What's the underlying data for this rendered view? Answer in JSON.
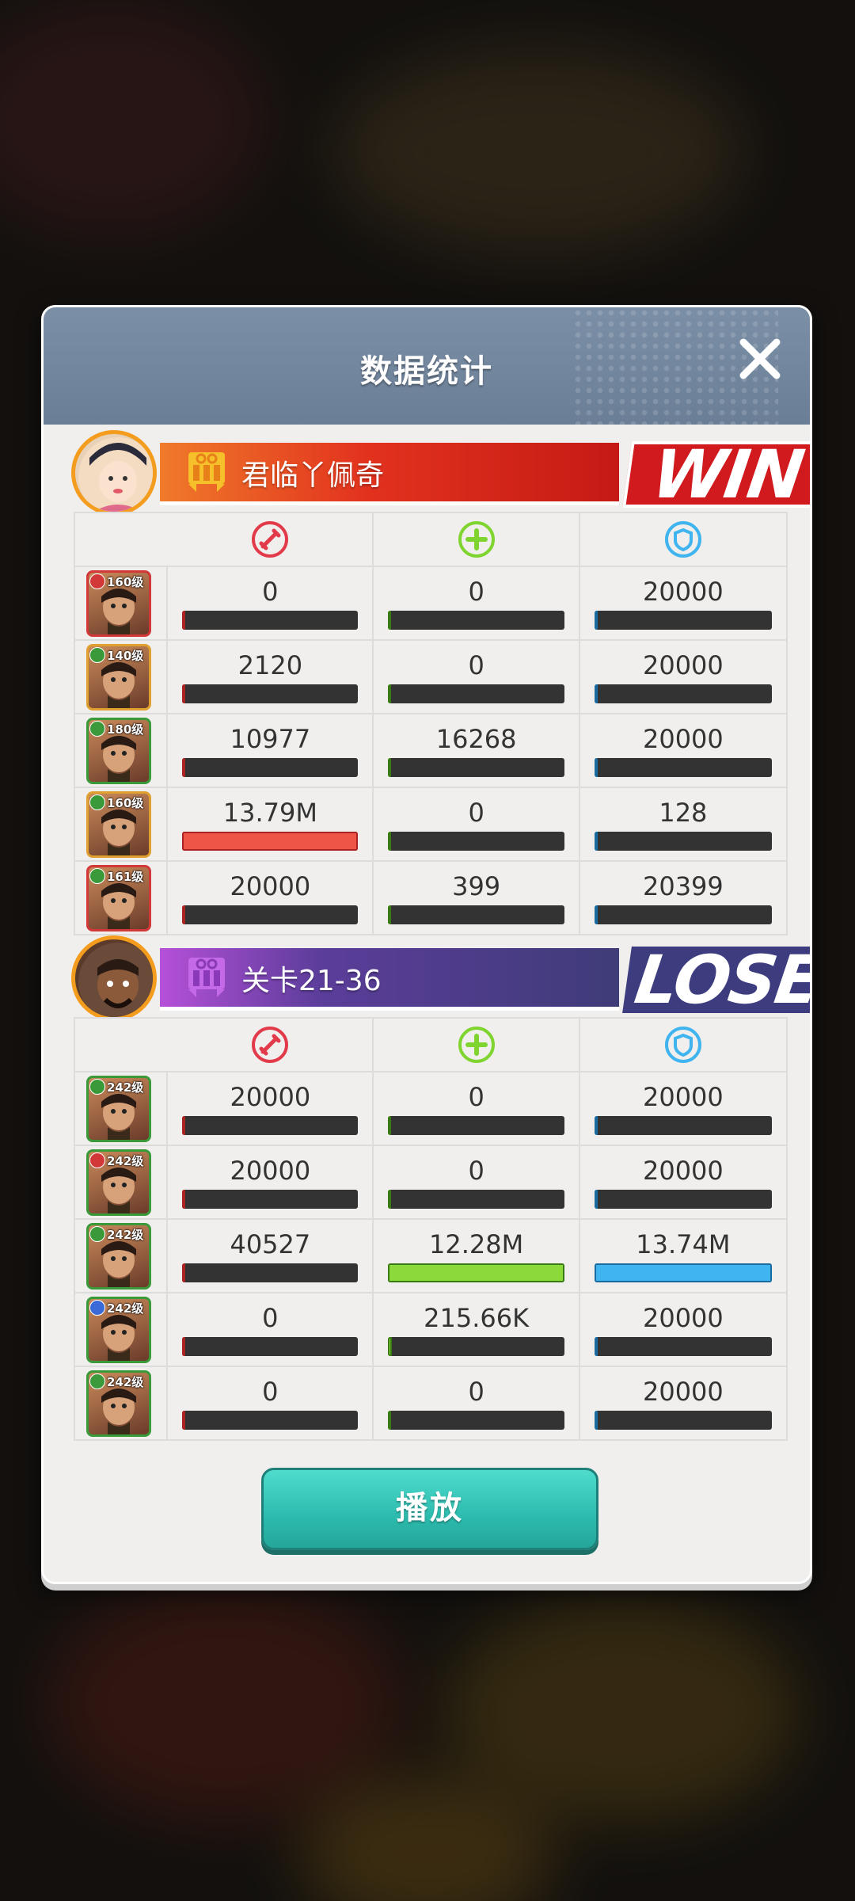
{
  "title": "数据统计",
  "close_icon": "close-icon",
  "colors": {
    "damage": "#e23a4a",
    "heal": "#8bd93b",
    "tank": "#3fb4ef",
    "header": "#7b8fa6",
    "play_button": "#2cbbae"
  },
  "teams": [
    {
      "name": "君临丫佩奇",
      "result": "WIN",
      "heroes": [
        {
          "level": "160级",
          "faction_color": "#d23838",
          "frame_color": "#d23838",
          "damage": "0",
          "heal": "0",
          "tank": "20000",
          "damage_fill": 0.0,
          "heal_fill": 0.0,
          "tank_fill": 0.0
        },
        {
          "level": "140级",
          "faction_color": "#3a9a3a",
          "frame_color": "#e0a030",
          "damage": "2120",
          "heal": "0",
          "tank": "20000",
          "damage_fill": 0.0,
          "heal_fill": 0.0,
          "tank_fill": 0.01
        },
        {
          "level": "180级",
          "faction_color": "#3a9a3a",
          "frame_color": "#3a9a3a",
          "damage": "10977",
          "heal": "16268",
          "tank": "20000",
          "damage_fill": 0.0,
          "heal_fill": 0.01,
          "tank_fill": 0.01
        },
        {
          "level": "160级",
          "faction_color": "#3a9a3a",
          "frame_color": "#e0a030",
          "damage": "13.79M",
          "heal": "0",
          "tank": "128",
          "damage_fill": 1.0,
          "heal_fill": 0.0,
          "tank_fill": 0.0
        },
        {
          "level": "161级",
          "faction_color": "#3a9a3a",
          "frame_color": "#d23838",
          "damage": "20000",
          "heal": "399",
          "tank": "20399",
          "damage_fill": 0.01,
          "heal_fill": 0.0,
          "tank_fill": 0.01
        }
      ]
    },
    {
      "name": "关卡21-36",
      "result": "LOSE",
      "heroes": [
        {
          "level": "242级",
          "faction_color": "#3a9a3a",
          "frame_color": "#3a9a3a",
          "damage": "20000",
          "heal": "0",
          "tank": "20000",
          "damage_fill": 0.01,
          "heal_fill": 0.0,
          "tank_fill": 0.01
        },
        {
          "level": "242级",
          "faction_color": "#d23838",
          "frame_color": "#3a9a3a",
          "damage": "20000",
          "heal": "0",
          "tank": "20000",
          "damage_fill": 0.01,
          "heal_fill": 0.0,
          "tank_fill": 0.01
        },
        {
          "level": "242级",
          "faction_color": "#3a9a3a",
          "frame_color": "#3a9a3a",
          "damage": "40527",
          "heal": "12.28M",
          "tank": "13.74M",
          "damage_fill": 0.01,
          "heal_fill": 1.0,
          "tank_fill": 1.0
        },
        {
          "level": "242级",
          "faction_color": "#3a6ad8",
          "frame_color": "#3a9a3a",
          "damage": "0",
          "heal": "215.66K",
          "tank": "20000",
          "damage_fill": 0.0,
          "heal_fill": 0.02,
          "tank_fill": 0.01
        },
        {
          "level": "242级",
          "faction_color": "#3a9a3a",
          "frame_color": "#3a9a3a",
          "damage": "0",
          "heal": "0",
          "tank": "20000",
          "damage_fill": 0.0,
          "heal_fill": 0.0,
          "tank_fill": 0.01
        }
      ]
    }
  ],
  "play_button": "播放"
}
